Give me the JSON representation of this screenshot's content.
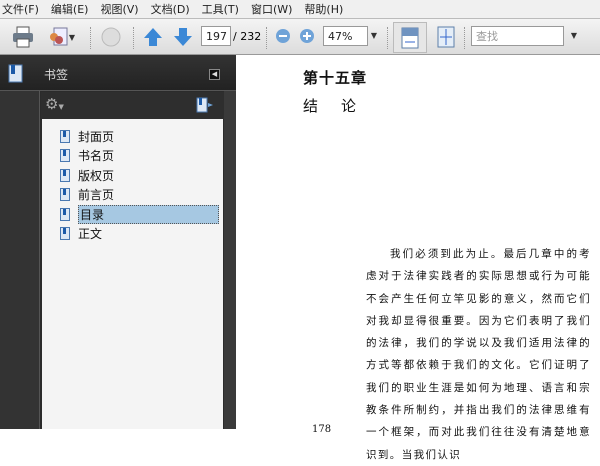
{
  "menu": [
    "文件(F)",
    "编辑(E)",
    "视图(V)",
    "文档(D)",
    "工具(T)",
    "窗口(W)",
    "帮助(H)"
  ],
  "toolbar": {
    "page_current": "197",
    "page_total": "/ 232",
    "zoom": "47%",
    "search_placeholder": "查找"
  },
  "sidebar": {
    "title": "书签",
    "bookmarks": [
      "封面页",
      "书名页",
      "版权页",
      "前言页",
      "目录",
      "正文"
    ],
    "selected": "目录"
  },
  "document": {
    "chapter": "第十五章",
    "title": "结　论",
    "paragraph": "我们必须到此为止。最后几章中的考虑对于法律实践者的实际思想或行为可能不会产生任何立竿见影的意义，然而它们对我却显得很重要。因为它们表明了我们的法律，我们的学说以及我们适用法律的方式等都依赖于我们的文化。它们证明了我们的职业生涯是如何为地理、语言和宗教条件所制约，并指出我们的法律思维有一个框架，而对此我们往往没有清楚地意识到。当我们认识",
    "page_number": "178"
  }
}
